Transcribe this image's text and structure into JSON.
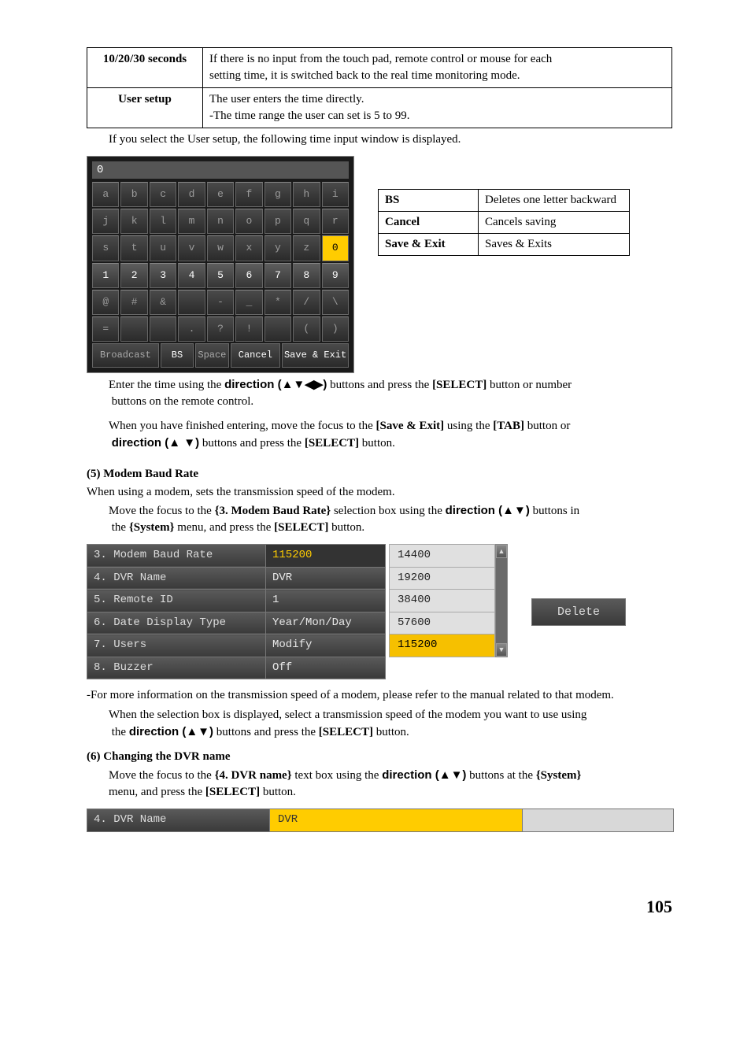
{
  "settingsTable": {
    "r1c1": "10/20/30 seconds",
    "r1c2a": "If there is no input from the touch pad, remote control or mouse for each",
    "r1c2b": "setting time, it is switched back to the real time monitoring mode.",
    "r2c1": "User setup",
    "r2c2a": "The user enters the time directly.",
    "r2c2b": "-The time range the user can set is 5 to 99."
  },
  "afterSettings": "If you select the User setup, the following time input window is displayed.",
  "kb": {
    "title": "0",
    "rows": [
      [
        "a",
        "b",
        "c",
        "d",
        "e",
        "f",
        "g",
        "h",
        "i"
      ],
      [
        "j",
        "k",
        "l",
        "m",
        "n",
        "o",
        "p",
        "q",
        "r"
      ],
      [
        "s",
        "t",
        "u",
        "v",
        "w",
        "x",
        "y",
        "z",
        "0"
      ],
      [
        "1",
        "2",
        "3",
        "4",
        "5",
        "6",
        "7",
        "8",
        "9"
      ],
      [
        "@",
        "#",
        "&",
        "",
        "-",
        "_",
        "*",
        "/",
        "\\"
      ],
      [
        "=",
        "",
        "",
        ".",
        "?",
        "!",
        "",
        "(",
        ")"
      ]
    ],
    "numRowIndex": 3,
    "hlRow": 2,
    "hlCol": 8,
    "bottom": {
      "broadcast": "Broadcast",
      "bs": "BS",
      "space": "Space",
      "cancel": "Cancel",
      "save": "Save & Exit"
    }
  },
  "legend": {
    "bs": "BS",
    "bsDesc": "Deletes one letter backward",
    "cancel": "Cancel",
    "cancelDesc": "Cancels saving",
    "save": "Save & Exit",
    "saveDesc": "Saves & Exits"
  },
  "enterLine1a": "Enter the time using the ",
  "enterLine1b": "direction (▲▼◀▶)",
  "enterLine1c": " buttons and press the ",
  "enterLine1d": "[SELECT]",
  "enterLine1e": " button or number",
  "enterLine2": "buttons on the remote control.",
  "enterLine3a": "When you have finished entering, move the focus to the ",
  "enterLine3b": "[Save & Exit]",
  "enterLine3c": " using the ",
  "enterLine3d": "[TAB]",
  "enterLine3e": " button or",
  "enterLine4a": "direction (▲ ▼)",
  "enterLine4b": " buttons and press the ",
  "enterLine4c": "[SELECT]",
  "enterLine4d": " button.",
  "sec5Head": "(5)  Modem Baud Rate",
  "sec5Intro": "When using a modem, sets the transmission speed of the modem.",
  "sec5MoveA": "Move the focus to the ",
  "sec5MoveB": "{3. Modem Baud Rate}",
  "sec5MoveC": " selection box using the ",
  "sec5MoveD": "direction (▲▼)",
  "sec5MoveE": " buttons in",
  "sec5MoveF": "the ",
  "sec5MoveG": "{System}",
  "sec5MoveH": " menu, and press the ",
  "sec5MoveI": "[SELECT]",
  "sec5MoveJ": " button.",
  "sysRows": [
    {
      "label": "3. Modem Baud Rate",
      "value": "115200",
      "hl": true
    },
    {
      "label": "4. DVR Name",
      "value": "DVR"
    },
    {
      "label": "5. Remote ID",
      "value": "1"
    },
    {
      "label": "6. Date Display Type",
      "value": "Year/Mon/Day"
    },
    {
      "label": "7. Users",
      "value": "Modify"
    },
    {
      "label": "8. Buzzer",
      "value": "Off"
    }
  ],
  "baudOptions": [
    "14400",
    "19200",
    "38400",
    "57600",
    "115200"
  ],
  "baudSelected": "115200",
  "deleteLabel": "Delete",
  "afterSys1": "-For more information on the transmission speed of a modem, please refer to the manual related to that modem.",
  "afterSys2a": "When the selection box is displayed, select a transmission speed of the modem you want to use using",
  "afterSys2b": "the ",
  "afterSys2c": "direction (▲▼)",
  "afterSys2d": " buttons and press the ",
  "afterSys2e": "[SELECT]",
  "afterSys2f": " button.",
  "sec6Head": "(6)  Changing the DVR name",
  "sec6a": "Move the focus to the ",
  "sec6b": "{4. DVR name}",
  "sec6c": " text box using the ",
  "sec6d": "direction (▲▼)",
  "sec6e": " buttons at the ",
  "sec6f": "{System}",
  "sec6g": "menu, and press the ",
  "sec6h": "[SELECT]",
  "sec6i": " button.",
  "dvrBar": {
    "label": "4. DVR Name",
    "value": "DVR"
  },
  "pageNum": "105"
}
